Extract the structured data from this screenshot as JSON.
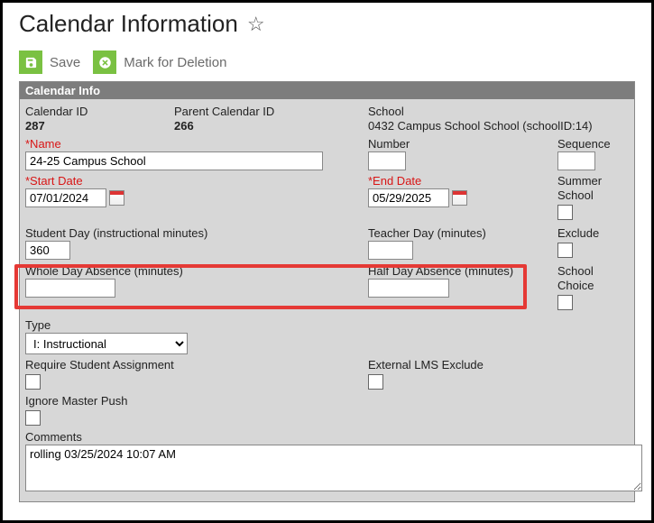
{
  "header": {
    "title": "Calendar Information"
  },
  "toolbar": {
    "save_label": "Save",
    "delete_label": "Mark for Deletion"
  },
  "panel": {
    "title": "Calendar Info",
    "calendar_id_label": "Calendar ID",
    "calendar_id_value": "287",
    "parent_cal_id_label": "Parent Calendar ID",
    "parent_cal_id_value": "266",
    "school_label": "School",
    "school_value": "0432 Campus School School (schoolID:14)",
    "name_label": "*Name",
    "name_value": "24-25 Campus School",
    "number_label": "Number",
    "number_value": "",
    "sequence_label": "Sequence",
    "sequence_value": "",
    "start_date_label": "*Start Date",
    "start_date_value": "07/01/2024",
    "end_date_label": "*End Date",
    "end_date_value": "05/29/2025",
    "summer_school_label": "Summer School",
    "student_day_label": "Student Day (instructional minutes)",
    "student_day_value": "360",
    "teacher_day_label": "Teacher Day (minutes)",
    "teacher_day_value": "",
    "exclude_label": "Exclude",
    "whole_day_label": "Whole Day Absence (minutes)",
    "whole_day_value": "",
    "half_day_label": "Half Day Absence (minutes)",
    "half_day_value": "",
    "school_choice_label": "School Choice",
    "type_label": "Type",
    "type_value": "I: Instructional",
    "require_assignment_label": "Require Student Assignment",
    "external_lms_label": "External LMS Exclude",
    "ignore_master_label": "Ignore Master Push",
    "comments_label": "Comments",
    "comments_value": "rolling 03/25/2024 10:07 AM"
  }
}
